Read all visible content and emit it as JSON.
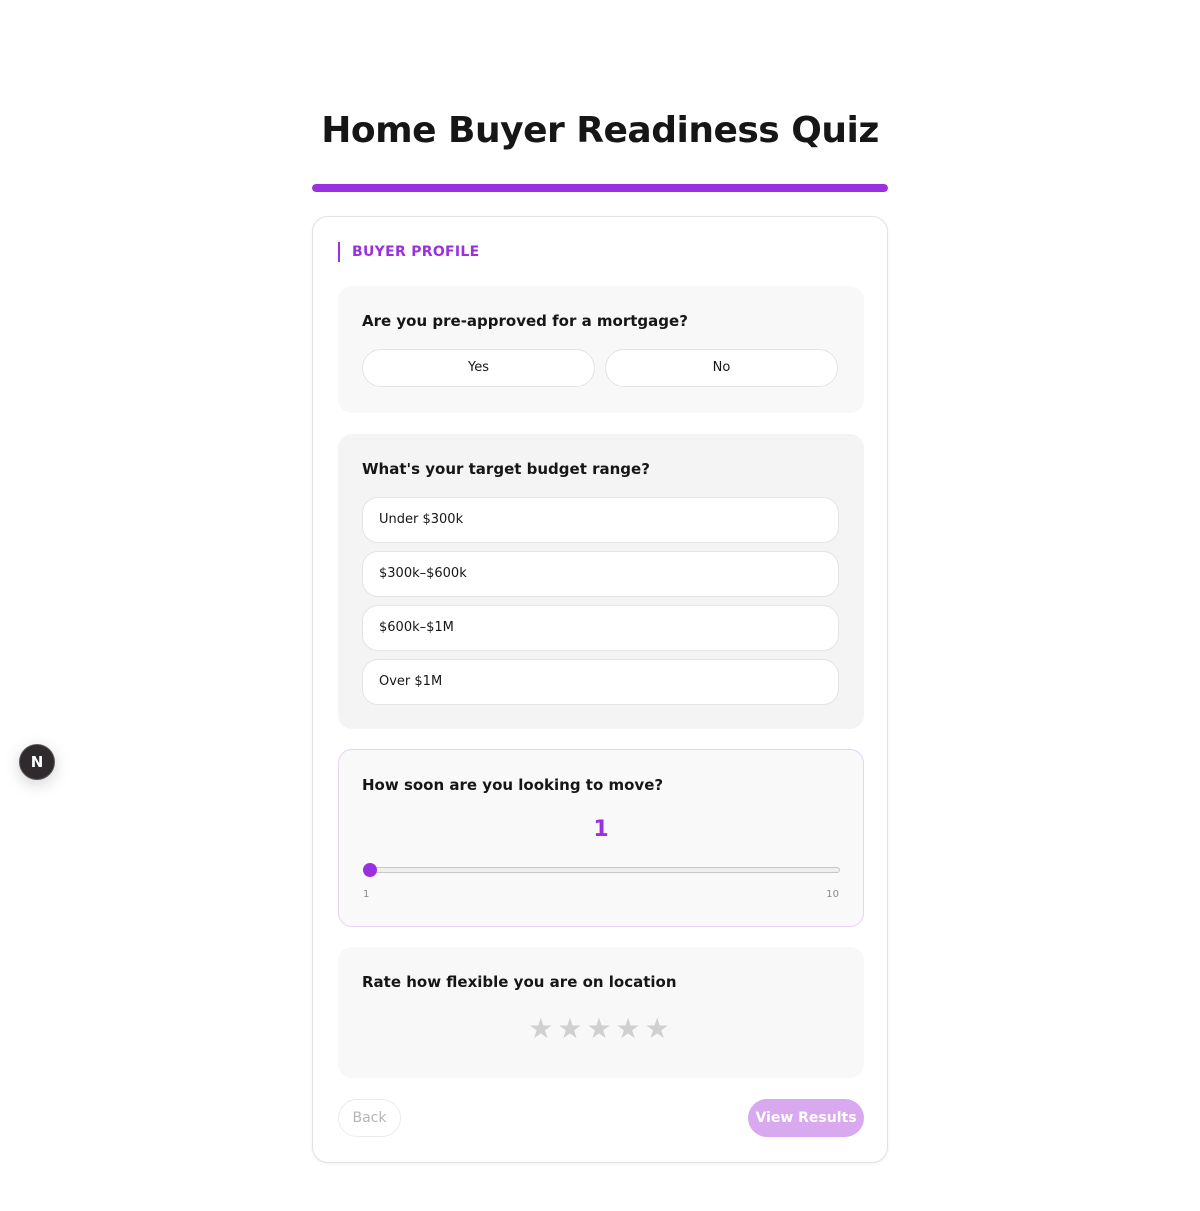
{
  "title": "Home Buyer Readiness Quiz",
  "colors": {
    "accent": "#9b30e0",
    "accent_muted": "#d8a9ef",
    "star_empty": "#d0d0d0"
  },
  "progress": {
    "fraction": 1.0
  },
  "section_label": "BUYER PROFILE",
  "q1": {
    "question": "Are you pre-approved for a mortgage?",
    "options": [
      "Yes",
      "No"
    ]
  },
  "q2": {
    "question": "What's your target budget range?",
    "options": [
      "Under $300k",
      "$300k–$600k",
      "$600k–$1M",
      "Over $1M"
    ]
  },
  "q3": {
    "question": "How soon are you looking to move?",
    "value": "1",
    "min": "1",
    "max": "10"
  },
  "q4": {
    "question": "Rate how flexible you are on location",
    "rating": 0,
    "max_rating": 5,
    "star_glyph": "★"
  },
  "nav": {
    "back_label": "Back",
    "next_label": "View Results"
  },
  "dev_badge": {
    "icon": "next-logo-icon",
    "glyph": "N"
  }
}
